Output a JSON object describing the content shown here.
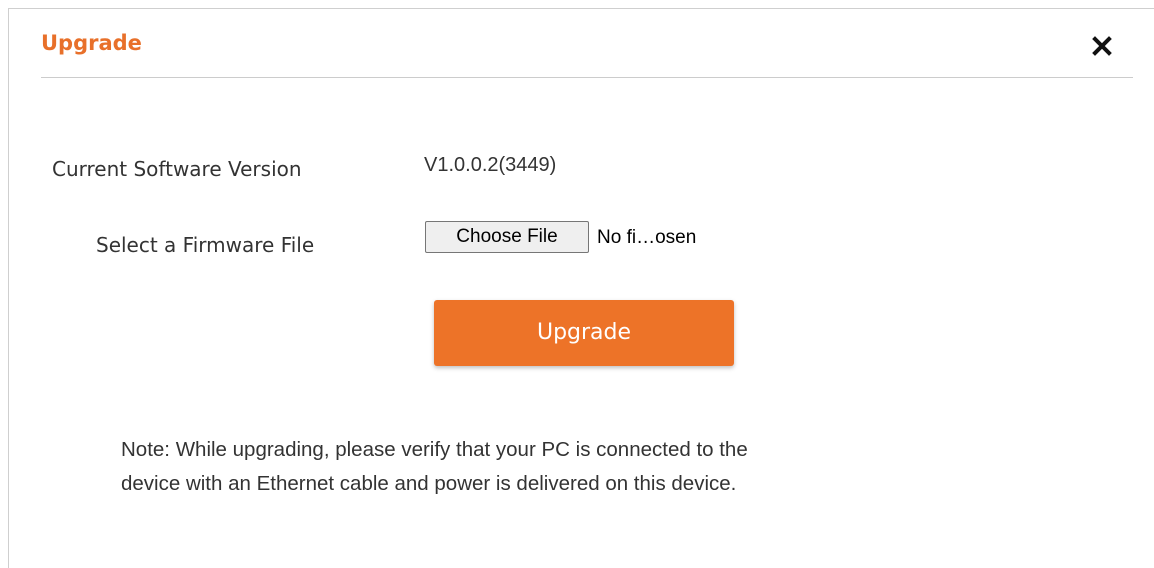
{
  "dialog": {
    "title": "Upgrade",
    "close_icon": "close-icon",
    "accent_color": "#e8702a"
  },
  "form": {
    "current_version_label": "Current Software Version",
    "current_version_value": "V1.0.0.2(3449)",
    "firmware_label": "Select a Firmware File",
    "choose_file_label": "Choose File",
    "file_status": "No fi…osen",
    "upgrade_button_label": "Upgrade",
    "button_color": "#ed7328"
  },
  "note": {
    "line1": "Note: While upgrading, please verify that your PC is connected to the",
    "line2": "device with an Ethernet cable and power is delivered on this device."
  }
}
